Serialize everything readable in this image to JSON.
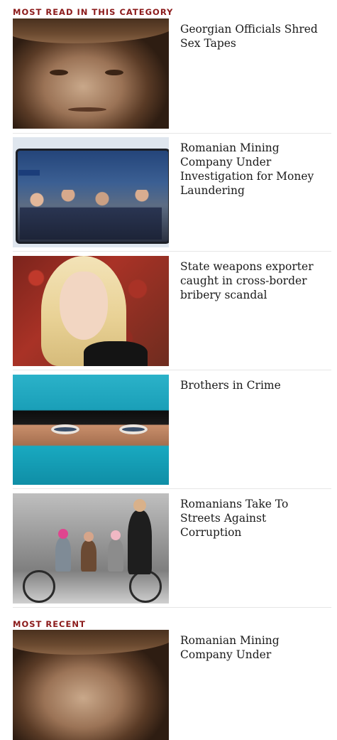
{
  "sections": {
    "most_read": {
      "heading": "MOST READ IN THIS CATEGORY",
      "articles": [
        {
          "title": "Georgian Officials Shred Sex Tapes",
          "image": "elderly-woman-sepia-photo"
        },
        {
          "title": "Romanian Mining Company Under Investigation for Money Laundering",
          "image": "bus-passengers-photo"
        },
        {
          "title": "State weapons exporter caught in cross-border bribery scandal",
          "image": "blonde-woman-red-leaves-photo"
        },
        {
          "title": "Brothers in Crime",
          "image": "turquoise-veil-eyes-photo"
        },
        {
          "title": "Romanians Take To Streets Against Corruption",
          "image": "family-tandem-bicycle-photo"
        }
      ]
    },
    "most_recent": {
      "heading": "MOST RECENT",
      "articles": [
        {
          "title": "Romanian Mining Company Under",
          "image": "elderly-woman-sepia-photo"
        }
      ]
    }
  },
  "colors": {
    "heading": "#8b1a1a",
    "headline": "#1a1a1a",
    "divider": "#e6e6e6"
  }
}
